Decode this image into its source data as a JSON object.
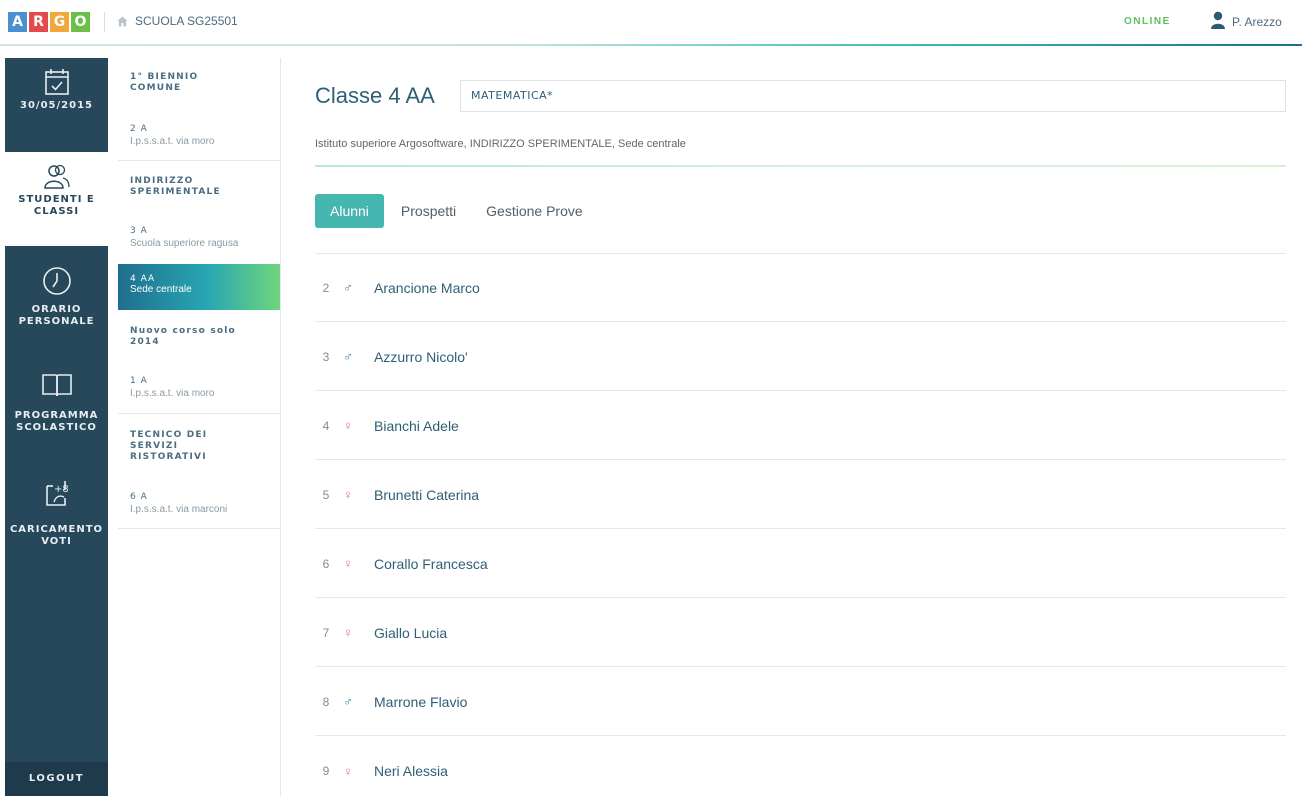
{
  "header": {
    "logo_letters": [
      "A",
      "R",
      "G",
      "O"
    ],
    "logo_colors": [
      "#4a8fd1",
      "#e24b4b",
      "#f1a73a",
      "#6cbf4a"
    ],
    "school": "SCUOLA SG25501",
    "status": "ONLINE",
    "user": "P. Arezzo"
  },
  "sidebar": {
    "items": [
      {
        "icon": "calendar-check-icon",
        "label": "30/05/2015"
      },
      {
        "icon": "students-icon",
        "label_line1": "STUDENTI E",
        "label_line2": "CLASSI"
      },
      {
        "icon": "clock-icon",
        "label_line1": "ORARIO",
        "label_line2": "PERSONALE"
      },
      {
        "icon": "book-icon",
        "label_line1": "PROGRAMMA",
        "label_line2": "SCOLASTICO"
      },
      {
        "icon": "grade-upload-icon",
        "label_line1": "CARICAMENTO",
        "label_line2": "VOTI"
      }
    ],
    "logout": "LOGOUT"
  },
  "classlist": {
    "groups": [
      {
        "title_line1": "1° BIENNIO",
        "title_line2": "COMUNE",
        "classes": [
          {
            "name": "2 A",
            "site": "I.p.s.s.a.t. via moro"
          }
        ]
      },
      {
        "title_line1": "INDIRIZZO",
        "title_line2": "SPERIMENTALE",
        "classes": [
          {
            "name": "3 A",
            "site": "Scuola superiore ragusa"
          },
          {
            "name": "4 AA",
            "site": "Sede centrale"
          }
        ]
      },
      {
        "title_line1": "Nuovo corso solo",
        "title_line2": "2014",
        "classes": [
          {
            "name": "1 A",
            "site": "I.p.s.s.a.t. via moro"
          }
        ]
      },
      {
        "title_line1": "TECNICO DEI",
        "title_line2": "SERVIZI",
        "title_line3": "RISTORATIVI",
        "classes": [
          {
            "name": "6 A",
            "site": "I.p.s.s.a.t. via marconi"
          }
        ]
      }
    ]
  },
  "main": {
    "title": "Classe 4 AA",
    "subject": "MATEMATICA*",
    "institute": "Istituto superiore Argosoftware, INDIRIZZO SPERIMENTALE, Sede centrale",
    "tabs": [
      "Alunni",
      "Prospetti",
      "Gestione Prove"
    ],
    "students": [
      {
        "num": "2",
        "gender": "♂",
        "name": "Arancione Marco"
      },
      {
        "num": "3",
        "gender": "♂",
        "name": "Azzurro Nicolo'"
      },
      {
        "num": "4",
        "gender": "♀",
        "name": "Bianchi Adele"
      },
      {
        "num": "5",
        "gender": "♀",
        "name": "Brunetti Caterina"
      },
      {
        "num": "6",
        "gender": "♀",
        "name": "Corallo Francesca"
      },
      {
        "num": "7",
        "gender": "♀",
        "name": "Giallo Lucia"
      },
      {
        "num": "8",
        "gender": "♂",
        "name": "Marrone Flavio"
      },
      {
        "num": "9",
        "gender": "♀",
        "name": "Neri Alessia"
      }
    ]
  }
}
